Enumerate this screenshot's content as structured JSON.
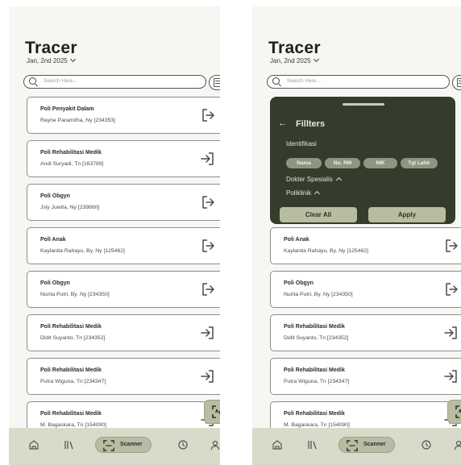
{
  "app": {
    "title": "Tracer",
    "date": "Jan, 2nd 2025",
    "search_placeholder": "Search Here..."
  },
  "queue_left": [
    {
      "poli": "Poli Penyakit Dalam",
      "patient": "Rayne Paramitha, Ny [234353]",
      "action": "exit-icon"
    },
    {
      "poli": "Poli Rehabilitasi Medik",
      "patient": "Andi Suryadi, Tn [163789]",
      "action": "enter-icon"
    },
    {
      "poli": "Poli Obgyn",
      "patient": "Jsly Juwita, Ny [239860]",
      "action": "exit-icon"
    },
    {
      "poli": "Poli Anak",
      "patient": "Kaylanita Rahayu, By. Ny [125462]",
      "action": "exit-icon"
    },
    {
      "poli": "Poli Obgyn",
      "patient": "Nurita Putri, By. Ny [234350]",
      "action": "exit-icon"
    },
    {
      "poli": "Poli Rehabilitasi Medik",
      "patient": "Didit Suyanto, Tn [234352]",
      "action": "enter-icon"
    },
    {
      "poli": "Poli Rehabilitasi Medik",
      "patient": "Putra Wiguna, Tn [234347]",
      "action": "enter-icon"
    },
    {
      "poli": "Poli Rehabilitasi Medik",
      "patient": "M. Bagaskara, Tn [154090]",
      "action": "enter-icon"
    }
  ],
  "queue_right": [
    {
      "poli": "Poli Anak",
      "patient": "Kaylanita Rahayu, By. Ny [125462]",
      "action": "exit-icon"
    },
    {
      "poli": "Poli Obgyn",
      "patient": "Nurita Putri, By. Ny [234350]",
      "action": "exit-icon"
    },
    {
      "poli": "Poli Rehabilitasi Medik",
      "patient": "Didit Suyanto, Tn [234352]",
      "action": "enter-icon"
    },
    {
      "poli": "Poli Rehabilitasi Medik",
      "patient": "Putra Wiguna, Tn [234347]",
      "action": "enter-icon"
    },
    {
      "poli": "Poli Rehabilitasi Medik",
      "patient": "M. Bagaskara, Tn [154090]",
      "action": "enter-icon"
    }
  ],
  "filter_panel": {
    "title": "Fillters",
    "identifikasi_label": "Identifikasi",
    "chips": [
      "Nama",
      "No. RM",
      "NIK",
      "Tgl Lahir"
    ],
    "dokter_label": "Dokter Spesialis",
    "poliklinik_label": "Poliklinik",
    "clear_label": "Clear All",
    "apply_label": "Apply"
  },
  "nav": {
    "items": [
      "home-icon",
      "books-icon",
      "scanner-icon",
      "history-icon",
      "profile-icon"
    ],
    "scanner_label": "Scanner"
  },
  "colors": {
    "panel_bg": "#353c2c",
    "nav_bg": "#d8dbc9",
    "accent": "#b8bca0",
    "chip": "#8f9580"
  }
}
